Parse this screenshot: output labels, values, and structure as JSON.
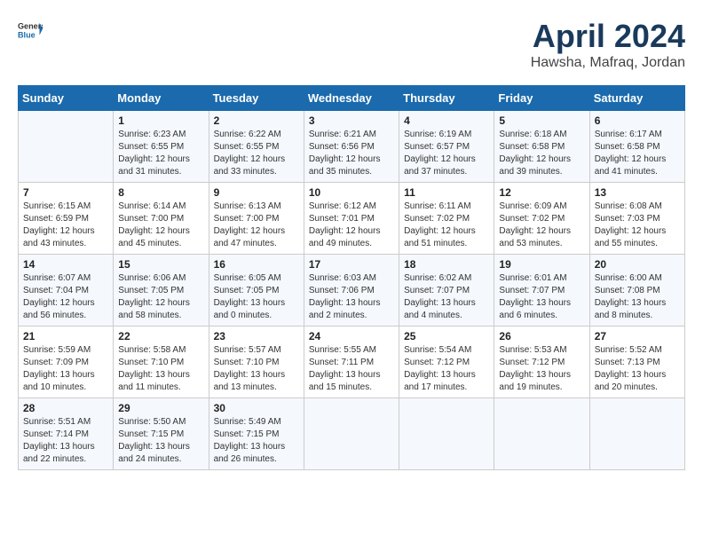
{
  "header": {
    "logo_general": "General",
    "logo_blue": "Blue",
    "month": "April 2024",
    "location": "Hawsha, Mafraq, Jordan"
  },
  "calendar": {
    "days_of_week": [
      "Sunday",
      "Monday",
      "Tuesday",
      "Wednesday",
      "Thursday",
      "Friday",
      "Saturday"
    ],
    "weeks": [
      [
        {
          "day": "",
          "info": ""
        },
        {
          "day": "1",
          "info": "Sunrise: 6:23 AM\nSunset: 6:55 PM\nDaylight: 12 hours\nand 31 minutes."
        },
        {
          "day": "2",
          "info": "Sunrise: 6:22 AM\nSunset: 6:55 PM\nDaylight: 12 hours\nand 33 minutes."
        },
        {
          "day": "3",
          "info": "Sunrise: 6:21 AM\nSunset: 6:56 PM\nDaylight: 12 hours\nand 35 minutes."
        },
        {
          "day": "4",
          "info": "Sunrise: 6:19 AM\nSunset: 6:57 PM\nDaylight: 12 hours\nand 37 minutes."
        },
        {
          "day": "5",
          "info": "Sunrise: 6:18 AM\nSunset: 6:58 PM\nDaylight: 12 hours\nand 39 minutes."
        },
        {
          "day": "6",
          "info": "Sunrise: 6:17 AM\nSunset: 6:58 PM\nDaylight: 12 hours\nand 41 minutes."
        }
      ],
      [
        {
          "day": "7",
          "info": "Sunrise: 6:15 AM\nSunset: 6:59 PM\nDaylight: 12 hours\nand 43 minutes."
        },
        {
          "day": "8",
          "info": "Sunrise: 6:14 AM\nSunset: 7:00 PM\nDaylight: 12 hours\nand 45 minutes."
        },
        {
          "day": "9",
          "info": "Sunrise: 6:13 AM\nSunset: 7:00 PM\nDaylight: 12 hours\nand 47 minutes."
        },
        {
          "day": "10",
          "info": "Sunrise: 6:12 AM\nSunset: 7:01 PM\nDaylight: 12 hours\nand 49 minutes."
        },
        {
          "day": "11",
          "info": "Sunrise: 6:11 AM\nSunset: 7:02 PM\nDaylight: 12 hours\nand 51 minutes."
        },
        {
          "day": "12",
          "info": "Sunrise: 6:09 AM\nSunset: 7:02 PM\nDaylight: 12 hours\nand 53 minutes."
        },
        {
          "day": "13",
          "info": "Sunrise: 6:08 AM\nSunset: 7:03 PM\nDaylight: 12 hours\nand 55 minutes."
        }
      ],
      [
        {
          "day": "14",
          "info": "Sunrise: 6:07 AM\nSunset: 7:04 PM\nDaylight: 12 hours\nand 56 minutes."
        },
        {
          "day": "15",
          "info": "Sunrise: 6:06 AM\nSunset: 7:05 PM\nDaylight: 12 hours\nand 58 minutes."
        },
        {
          "day": "16",
          "info": "Sunrise: 6:05 AM\nSunset: 7:05 PM\nDaylight: 13 hours\nand 0 minutes."
        },
        {
          "day": "17",
          "info": "Sunrise: 6:03 AM\nSunset: 7:06 PM\nDaylight: 13 hours\nand 2 minutes."
        },
        {
          "day": "18",
          "info": "Sunrise: 6:02 AM\nSunset: 7:07 PM\nDaylight: 13 hours\nand 4 minutes."
        },
        {
          "day": "19",
          "info": "Sunrise: 6:01 AM\nSunset: 7:07 PM\nDaylight: 13 hours\nand 6 minutes."
        },
        {
          "day": "20",
          "info": "Sunrise: 6:00 AM\nSunset: 7:08 PM\nDaylight: 13 hours\nand 8 minutes."
        }
      ],
      [
        {
          "day": "21",
          "info": "Sunrise: 5:59 AM\nSunset: 7:09 PM\nDaylight: 13 hours\nand 10 minutes."
        },
        {
          "day": "22",
          "info": "Sunrise: 5:58 AM\nSunset: 7:10 PM\nDaylight: 13 hours\nand 11 minutes."
        },
        {
          "day": "23",
          "info": "Sunrise: 5:57 AM\nSunset: 7:10 PM\nDaylight: 13 hours\nand 13 minutes."
        },
        {
          "day": "24",
          "info": "Sunrise: 5:55 AM\nSunset: 7:11 PM\nDaylight: 13 hours\nand 15 minutes."
        },
        {
          "day": "25",
          "info": "Sunrise: 5:54 AM\nSunset: 7:12 PM\nDaylight: 13 hours\nand 17 minutes."
        },
        {
          "day": "26",
          "info": "Sunrise: 5:53 AM\nSunset: 7:12 PM\nDaylight: 13 hours\nand 19 minutes."
        },
        {
          "day": "27",
          "info": "Sunrise: 5:52 AM\nSunset: 7:13 PM\nDaylight: 13 hours\nand 20 minutes."
        }
      ],
      [
        {
          "day": "28",
          "info": "Sunrise: 5:51 AM\nSunset: 7:14 PM\nDaylight: 13 hours\nand 22 minutes."
        },
        {
          "day": "29",
          "info": "Sunrise: 5:50 AM\nSunset: 7:15 PM\nDaylight: 13 hours\nand 24 minutes."
        },
        {
          "day": "30",
          "info": "Sunrise: 5:49 AM\nSunset: 7:15 PM\nDaylight: 13 hours\nand 26 minutes."
        },
        {
          "day": "",
          "info": ""
        },
        {
          "day": "",
          "info": ""
        },
        {
          "day": "",
          "info": ""
        },
        {
          "day": "",
          "info": ""
        }
      ]
    ]
  }
}
